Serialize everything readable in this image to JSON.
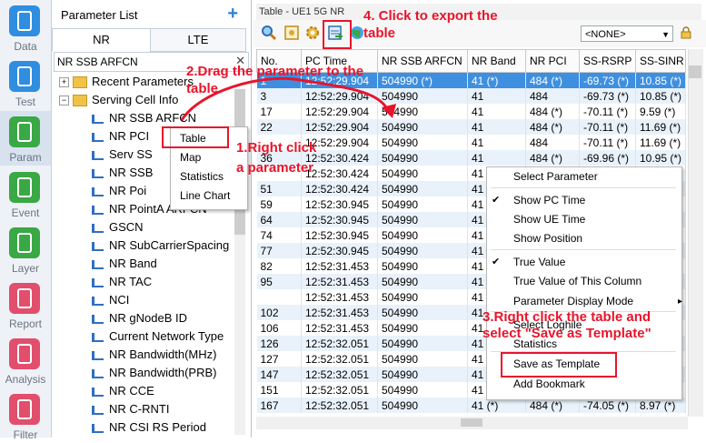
{
  "nav": [
    {
      "label": "Data",
      "icon": "phone-data-icon",
      "color": "#2f8ee0"
    },
    {
      "label": "Test",
      "icon": "phone-test-icon",
      "color": "#2f8ee0"
    },
    {
      "label": "Param",
      "icon": "grid-param-icon",
      "color": "#39a845"
    },
    {
      "label": "Event",
      "icon": "list-event-icon",
      "color": "#39a845"
    },
    {
      "label": "Layer",
      "icon": "map-layer-icon",
      "color": "#39a845"
    },
    {
      "label": "Report",
      "icon": "report-icon",
      "color": "#e14f6d"
    },
    {
      "label": "Analysis",
      "icon": "analysis-icon",
      "color": "#e14f6d"
    },
    {
      "label": "Filter",
      "icon": "filter-icon",
      "color": "#e14f6d"
    }
  ],
  "param_panel": {
    "title": "Parameter List",
    "add_symbol": "+",
    "tabs": [
      "NR",
      "LTE"
    ],
    "search_value": "NR SSB ARFCN",
    "search_clear": "✕",
    "tree": [
      {
        "type": "folder",
        "label": "Recent Parameters",
        "expander": "+"
      },
      {
        "type": "folder",
        "label": "Serving Cell Info",
        "expander": "−"
      },
      {
        "type": "param",
        "label": "NR SSB ARFCN"
      },
      {
        "type": "param",
        "label": "NR PCI"
      },
      {
        "type": "param",
        "label": "Serv SS"
      },
      {
        "type": "param",
        "label": "NR SSB"
      },
      {
        "type": "param",
        "label": "NR Poi"
      },
      {
        "type": "param",
        "label": "NR PointA ARFCN"
      },
      {
        "type": "param",
        "label": "GSCN"
      },
      {
        "type": "param",
        "label": "NR SubCarrierSpacing"
      },
      {
        "type": "param",
        "label": "NR Band"
      },
      {
        "type": "param",
        "label": "NR TAC"
      },
      {
        "type": "param",
        "label": "NCI"
      },
      {
        "type": "param",
        "label": "NR gNodeB ID"
      },
      {
        "type": "param",
        "label": "Current Network Type"
      },
      {
        "type": "param",
        "label": "NR Bandwidth(MHz)"
      },
      {
        "type": "param",
        "label": "NR Bandwidth(PRB)"
      },
      {
        "type": "param",
        "label": "NR CCE"
      },
      {
        "type": "param",
        "label": "NR C-RNTI"
      },
      {
        "type": "param",
        "label": "NR CSI RS Period"
      }
    ]
  },
  "param_context_menu": [
    "Table",
    "Map",
    "Statistics",
    "Line Chart"
  ],
  "table_window": {
    "title": "Table - UE1 5G NR",
    "selector_value": "<NONE>",
    "columns": [
      "No.",
      "PC Time",
      "NR SSB ARFCN",
      "NR Band",
      "NR PCI",
      "SS-RSRP",
      "SS-SINR"
    ],
    "rows": [
      [
        "1",
        "12:52:29.904",
        "504990 (*)",
        "41 (*)",
        "484 (*)",
        "-69.73 (*)",
        "10.85 (*)"
      ],
      [
        "3",
        "12:52:29.904",
        "504990",
        "41",
        "484",
        "-69.73 (*)",
        "10.85 (*)"
      ],
      [
        "17",
        "12:52:29.904",
        "504990",
        "41",
        "484 (*)",
        "-70.11 (*)",
        "9.59 (*)"
      ],
      [
        "22",
        "12:52:29.904",
        "504990",
        "41",
        "484 (*)",
        "-70.11 (*)",
        "11.69 (*)"
      ],
      [
        "",
        "12:52:29.904",
        "504990",
        "41",
        "484",
        "-70.11 (*)",
        "11.69 (*)"
      ],
      [
        "36",
        "12:52:30.424",
        "504990",
        "41",
        "484 (*)",
        "-69.96 (*)",
        "10.95 (*)"
      ],
      [
        "",
        "12:52:30.424",
        "504990",
        "41",
        "",
        "",
        ""
      ],
      [
        "51",
        "12:52:30.424",
        "504990",
        "41",
        "",
        "",
        ""
      ],
      [
        "59",
        "12:52:30.945",
        "504990",
        "41",
        "",
        "",
        ""
      ],
      [
        "64",
        "12:52:30.945",
        "504990",
        "41",
        "",
        "",
        ""
      ],
      [
        "74",
        "12:52:30.945",
        "504990",
        "41",
        "",
        "",
        ""
      ],
      [
        "77",
        "12:52:30.945",
        "504990",
        "41",
        "",
        "",
        ""
      ],
      [
        "82",
        "12:52:31.453",
        "504990",
        "41",
        "",
        "",
        ""
      ],
      [
        "95",
        "12:52:31.453",
        "504990",
        "41",
        "",
        "",
        ""
      ],
      [
        "",
        "12:52:31.453",
        "504990",
        "41",
        "",
        "",
        ""
      ],
      [
        "102",
        "12:52:31.453",
        "504990",
        "41",
        "",
        "",
        ""
      ],
      [
        "106",
        "12:52:31.453",
        "504990",
        "41",
        "",
        "",
        ""
      ],
      [
        "126",
        "12:52:32.051",
        "504990",
        "41",
        "",
        "",
        ""
      ],
      [
        "127",
        "12:52:32.051",
        "504990",
        "41",
        "",
        "",
        ""
      ],
      [
        "147",
        "12:52:32.051",
        "504990",
        "41",
        "",
        "",
        ""
      ],
      [
        "151",
        "12:52:32.051",
        "504990",
        "41",
        "",
        "",
        ""
      ],
      [
        "167",
        "12:52:32.051",
        "504990",
        "41 (*)",
        "484 (*)",
        "-74.05 (*)",
        "8.97 (*)"
      ]
    ]
  },
  "table_context_menu": [
    {
      "label": "Select Parameter",
      "check": ""
    },
    {
      "label": "Show PC Time",
      "check": "✔"
    },
    {
      "label": "Show UE Time",
      "check": ""
    },
    {
      "label": "Show Position",
      "check": ""
    },
    {
      "label": "True Value",
      "check": "✔"
    },
    {
      "label": "True Value of This Column",
      "check": ""
    },
    {
      "label": "Parameter Display Mode",
      "check": "",
      "submenu": "▸"
    },
    {
      "label": "Select Loghile",
      "check": ""
    },
    {
      "label": "Statistics",
      "check": ""
    },
    {
      "label": "Save as Template",
      "check": ""
    },
    {
      "label": "Add Bookmark",
      "check": ""
    }
  ],
  "annotations": {
    "step1": "1.Right click a parameter",
    "step2": "2.Drag the parameter to the table",
    "step3": "3.Right click the table and select \"Save as Template\"",
    "step4": "4. Click to export the table",
    "accent_color": "#e8142b"
  }
}
